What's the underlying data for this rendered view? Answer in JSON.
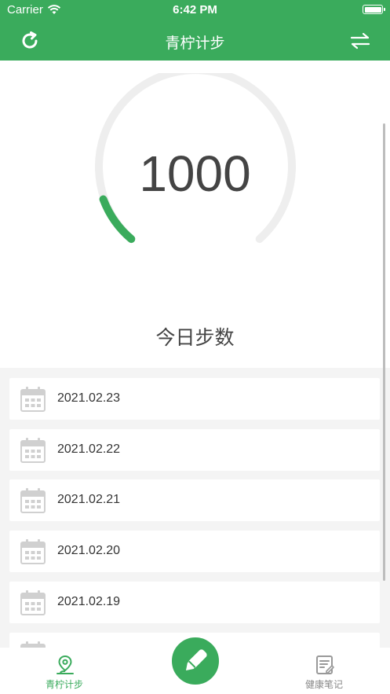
{
  "status_bar": {
    "carrier": "Carrier",
    "time": "6:42 PM"
  },
  "nav": {
    "title": "青柠计步",
    "refresh_icon": "refresh-icon",
    "swap_icon": "swap-arrows-icon"
  },
  "colors": {
    "primary": "#3aab5c",
    "track": "#eeeeee",
    "text": "#444444"
  },
  "gauge": {
    "value": "1000",
    "label": "今日步数"
  },
  "history": [
    {
      "date": "2021.02.23"
    },
    {
      "date": "2021.02.22"
    },
    {
      "date": "2021.02.21"
    },
    {
      "date": "2021.02.20"
    },
    {
      "date": "2021.02.19"
    },
    {
      "date": ""
    }
  ],
  "tabs": {
    "left": {
      "label": "青柠计步",
      "icon": "location-pin-icon"
    },
    "center": {
      "icon": "pencil-icon"
    },
    "right": {
      "label": "健康笔记",
      "icon": "note-icon"
    }
  }
}
